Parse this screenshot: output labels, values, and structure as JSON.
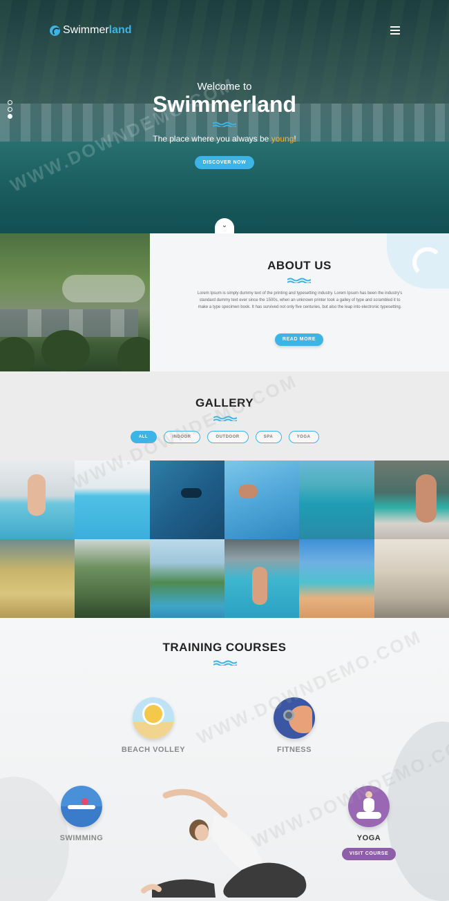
{
  "header": {
    "logo_text_light": "Swimmer",
    "logo_text_bold": "land",
    "menu_icon": "hamburger-menu-icon"
  },
  "hero": {
    "welcome": "Welcome to",
    "title": "Swimmerland",
    "tagline_prefix": "The place where you always be ",
    "tagline_highlight": "young",
    "tagline_suffix": "!",
    "cta": "DISCOVER NOW",
    "slide_count": 3,
    "active_slide": 3
  },
  "about": {
    "title": "ABOUT US",
    "body": "Lorem Ipsum is simply dummy text of the printing and typesetting industry. Lorem Ipsum has been the industry's standard dummy text ever since the 1500s, when an unknown printer took a galley of type and scrambled it to make a type specimen book. It has survived not only five centuries, but also the leap into electronic typesetting.",
    "cta": "READ MORE"
  },
  "gallery": {
    "title": "GALLERY",
    "filters": [
      "ALL",
      "INDOOR",
      "OUTDOOR",
      "SPA",
      "YOGA"
    ],
    "active_filter": "ALL"
  },
  "training": {
    "title": "TRAINING COURSES",
    "courses": [
      {
        "name": "BEACH VOLLEY",
        "icon": "beach-volleyball-icon"
      },
      {
        "name": "FITNESS",
        "icon": "dumbbell-arm-icon"
      },
      {
        "name": "SWIMMING",
        "icon": "swimmer-icon"
      },
      {
        "name": "YOGA",
        "icon": "yoga-pose-icon"
      }
    ],
    "cta": "VISIT COURSE"
  },
  "watermark": "WWW.DOWNDEMO.COM",
  "colors": {
    "accent": "#3cb4e6",
    "highlight": "#f6b33a",
    "yoga_purple": "#8f5ea8",
    "hero_overlay": "#15474b"
  }
}
